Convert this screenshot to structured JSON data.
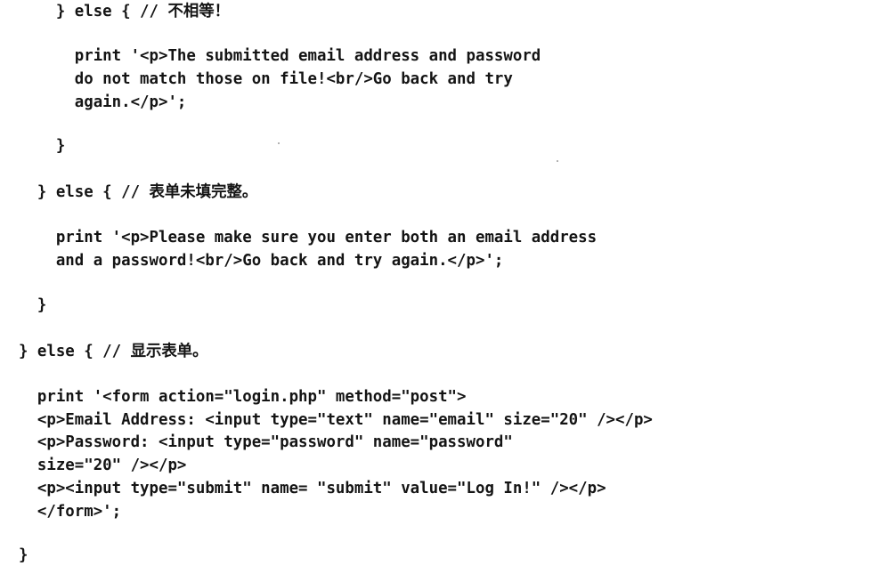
{
  "code_lines": [
    "      } else { // 不相等！",
    "        print '<p>The submitted email address and password",
    "        do not match those on file!<br/>Go back and try",
    "        again.</p>';",
    "      }",
    "    } else { // 表单未填完整。",
    "      print '<p>Please make sure you enter both an email address",
    "      and a password!<br/>Go back and try again.</p>';",
    "    }",
    "  } else { // 显示表单。",
    "    print '<form action=\"login.php\" method=\"post\">",
    "    <p>Email Address: <input type=\"text\" name=\"email\" size=\"20\" /></p>",
    "    <p>Password: <input type=\"password\" name=\"password\"",
    "    size=\"20\" /></p>",
    "    <p><input type=\"submit\" name= \"submit\" value=\"Log In!\" /></p>",
    "    </form>';",
    "  }"
  ]
}
